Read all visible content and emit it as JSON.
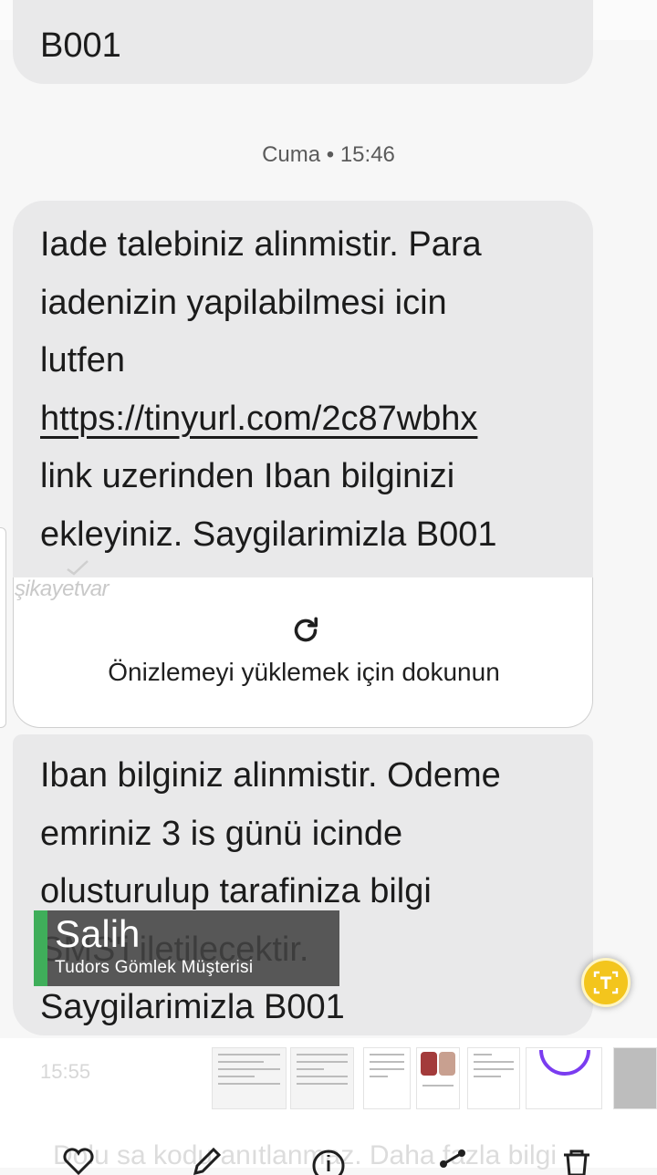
{
  "conversation": {
    "prev_message_tail": "B001",
    "timestamp": "Cuma • 15:46",
    "message1": {
      "lines": [
        "Iade talebiniz alinmistir. Para",
        "iadenizin yapilabilmesi icin",
        "lutfen"
      ],
      "link": "https://tinyurl.com/2c87wbhx",
      "after_lines": [
        "link uzerinden Iban bilginizi",
        "ekleyiniz. Saygilarimizla B001"
      ]
    },
    "link_preview": {
      "label": "Önizlemeyi yüklemek için dokunun"
    },
    "message2": {
      "lines": [
        "Iban bilginiz alinmistir. Odeme",
        "emriniz 3 is günü icinde",
        "olusturulup tarafiniza bilgi",
        "SMS'i iletilecektir.",
        "Saygilarimizla B001"
      ]
    }
  },
  "watermark": "şikayetvar",
  "video_caption": {
    "name": "Salih",
    "role": "Tudors Gömlek Müşterisi",
    "accent_color": "#3fae5a"
  },
  "translate_button": {
    "icon": "text-scan-icon",
    "color": "#f3c51d"
  },
  "thumbnail_strip": {
    "time": "15:55"
  },
  "bottom_bar": {
    "overlay_text": "Dolu sa kodu anıtlanmaz. Daha fazla bilgi",
    "icons": [
      "heart-icon",
      "edit-icon",
      "info-icon",
      "share-icon",
      "delete-icon"
    ]
  }
}
